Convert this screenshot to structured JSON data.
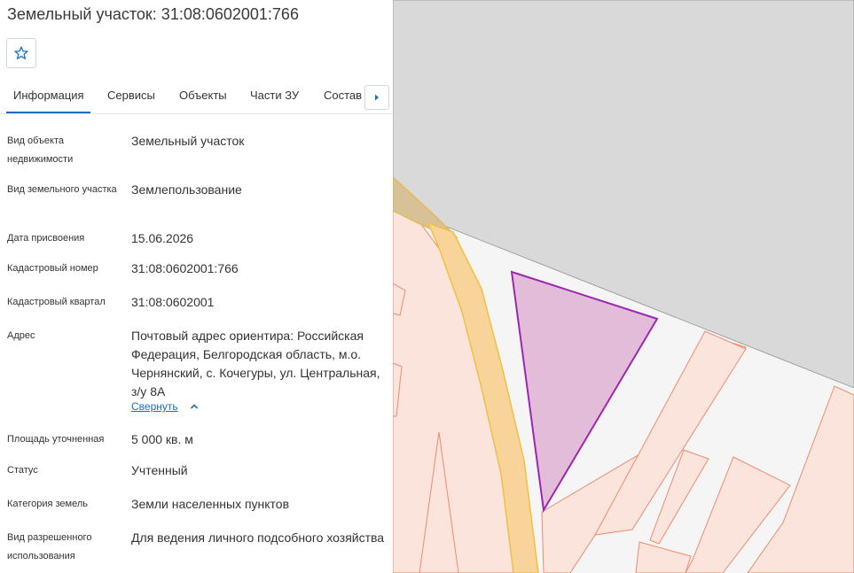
{
  "header": {
    "title": "Земельный участок: 31:08:0602001:766"
  },
  "favorite": {
    "icon": "star-icon"
  },
  "tabs": [
    {
      "label": "Информация",
      "active": true
    },
    {
      "label": "Сервисы",
      "active": false
    },
    {
      "label": "Объекты",
      "active": false
    },
    {
      "label": "Части ЗУ",
      "active": false
    },
    {
      "label": "Состав",
      "active": false
    }
  ],
  "info": {
    "object_type": {
      "label": "Вид объекта недвижимости",
      "value": "Земельный участок"
    },
    "land_type": {
      "label": "Вид земельного участка",
      "value": "Землепользование"
    },
    "assign_date": {
      "label": "Дата присвоения",
      "value": "15.06.2026"
    },
    "cadastral_number": {
      "label": "Кадастровый номер",
      "value": "31:08:0602001:766"
    },
    "cadastral_quarter": {
      "label": "Кадастровый квартал",
      "value": "31:08:0602001"
    },
    "address": {
      "label": "Адрес",
      "value": "Почтовый адрес ориентира: Российская Федерация, Белгородская область, м.о. Чернянский, с. Кочегуры, ул. Центральная, з/у 8А",
      "collapse_label": "Свернуть"
    },
    "area": {
      "label": "Площадь уточненная",
      "value": "5 000 кв. м"
    },
    "status": {
      "label": "Статус",
      "value": "Учтенный"
    },
    "land_category": {
      "label": "Категория земель",
      "value": "Земли населенных пунктов"
    },
    "permitted_use": {
      "label": "Вид разрешенного использования",
      "value": "Для ведения личного подсобного хозяйства"
    }
  },
  "map": {
    "colors": {
      "background": "#f5f5f5",
      "gray_zone": "#d9d9d9",
      "parcel_fill": "#fbe4dc",
      "parcel_stroke": "#ef8a6c",
      "road_fill": "#f8d49a",
      "road_stroke": "#f0c040",
      "selected_fill": "#e3bcd9",
      "selected_stroke": "#9c27b0",
      "olive_fill": "#d7c197"
    }
  }
}
